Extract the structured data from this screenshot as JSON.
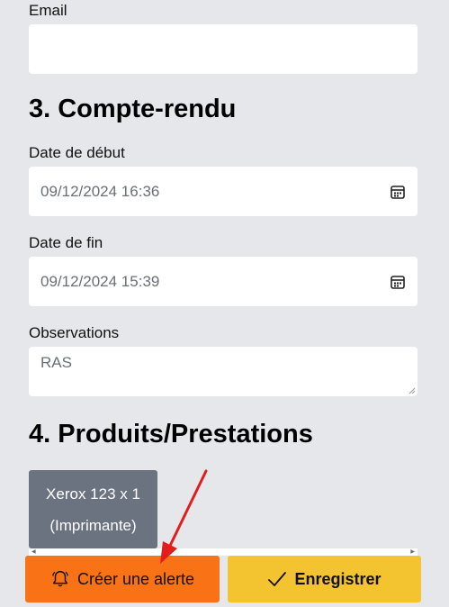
{
  "contact": {
    "email_label": "Email",
    "email_value": ""
  },
  "report": {
    "heading": "3. Compte-rendu",
    "start_label": "Date de début",
    "start_value": "09/12/2024 16:36",
    "end_label": "Date de fin",
    "end_value": "09/12/2024 15:39",
    "observations_label": "Observations",
    "observations_value": "RAS"
  },
  "products": {
    "heading": "4. Produits/Prestations",
    "items": [
      {
        "line1": "Xerox 123 x 1",
        "line2": "(Imprimante)"
      }
    ]
  },
  "actions": {
    "alert_label": "Créer une alerte",
    "save_label": "Enregistrer"
  },
  "colors": {
    "background": "#e5e7eb",
    "alert_button": "#f97316",
    "save_button": "#f4c430",
    "product_card": "#6b7280",
    "annotation_arrow": "#e11d1d"
  },
  "icons": {
    "calendar": "calendar-icon",
    "bell": "bell-icon",
    "check": "checkmark-icon"
  }
}
